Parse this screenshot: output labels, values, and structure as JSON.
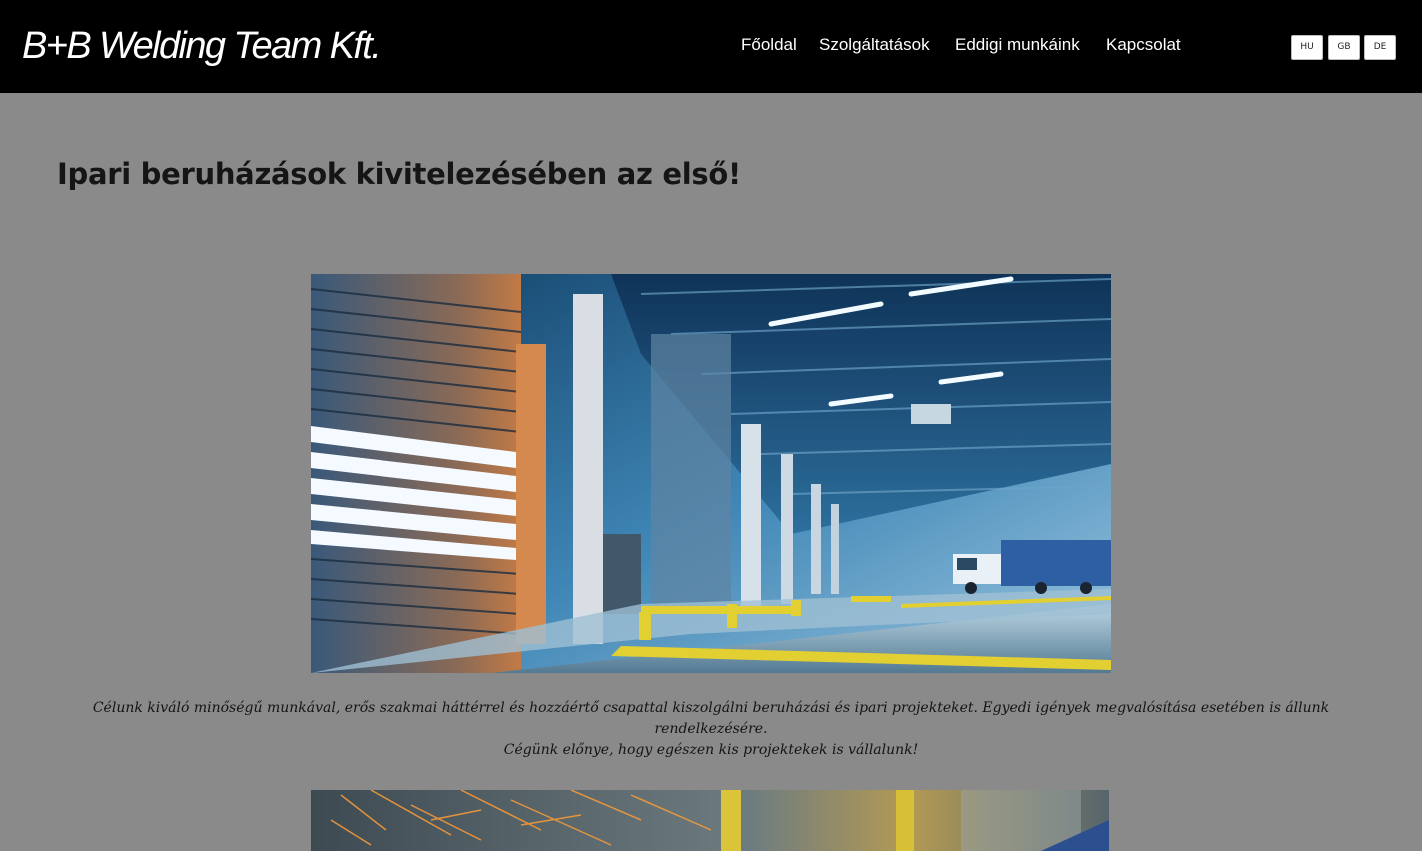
{
  "header": {
    "logo_text": "B+B Welding Team Kft.",
    "nav": [
      {
        "label": "Főoldal"
      },
      {
        "label": "Szolgáltatások"
      },
      {
        "label": "Eddigi munkáink"
      },
      {
        "label": "Kapcsolat"
      }
    ],
    "languages": [
      {
        "label": "HU"
      },
      {
        "label": "GB"
      },
      {
        "label": "DE"
      }
    ]
  },
  "main": {
    "headline": "Ipari beruházások kivitelezésében az első!",
    "hero_image": {
      "subject": "industrial-warehouse-photo"
    },
    "caption_line1": "Célunk kiváló minőségű munkával, erős szakmai háttérrel és hozzáértő csapattal kiszolgálni beruházási és ipari projekteket. Egyedi igények megvalósítása esetében is állunk rendelkezésére.",
    "caption_line2": "Cégünk előnye, hogy egészen kis projektekek is vállalunk!",
    "second_image": {
      "subject": "welding-sparks-photo"
    }
  },
  "colors": {
    "header_bg": "#000000",
    "page_bg": "#8a8a8a",
    "headline_text": "#151515"
  }
}
